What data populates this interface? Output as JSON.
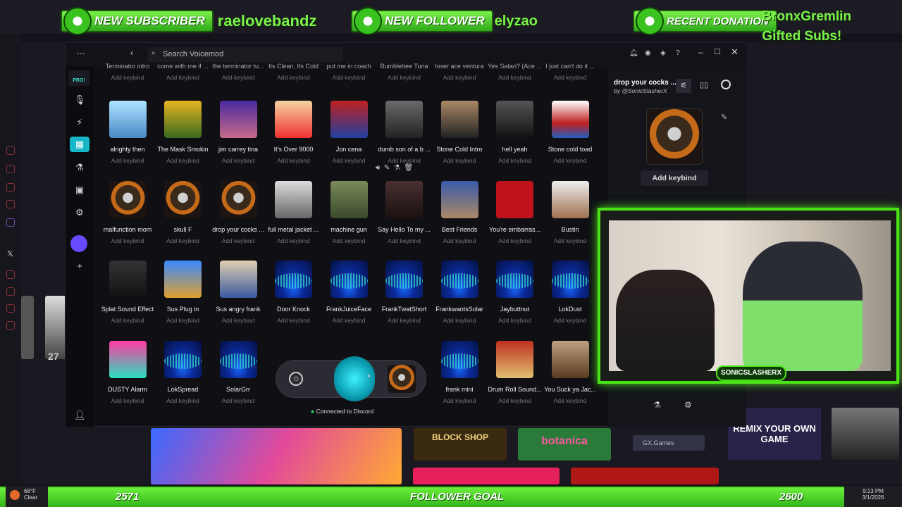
{
  "overlay": {
    "new_subscriber_label": "NEW SUBSCRIBER",
    "new_subscriber_name": "raelovebandz",
    "new_follower_label": "NEW FOLLOWER",
    "new_follower_name": "elyzao",
    "recent_donation_label": "RECENT DONATION",
    "donation_line1": "BronxGremlin",
    "donation_line2": "Gifted Subs!",
    "goal_start": "2571",
    "goal_label": "FOLLOWER GOAL",
    "goal_end": "2600",
    "cam_badge": "SONICSLASHERX"
  },
  "voicemod": {
    "search_placeholder": "Search Voicemod",
    "pro_badge": "PRO!",
    "top_row_labels": [
      "Terminator intro",
      "come with me if ...",
      "the terminator tu...",
      "Its Clean, Its Cold",
      "put me in coach",
      "Bumblebee Tuna",
      "loser ace ventura",
      "Yes Satan? (Ace ...",
      "I just can't do it ..."
    ],
    "keybind_label": "Add keybind",
    "rows": [
      [
        "alrighty then",
        "The Mask Smokin",
        "jim carrey tina",
        "It's Over 9000",
        "Jon cena",
        "dumb son of a b ...",
        "Stone Cold Intro",
        "hell yeah",
        "Stone cold toad"
      ],
      [
        "malfunction mom",
        "skull F",
        "drop your cocks ...",
        "full metal jacket ...",
        "machine gun",
        "Say Hello To my ...",
        "Best Friends",
        "You're embarras...",
        "Bustin"
      ],
      [
        "Splat Sound Effect",
        "Sus Plug in",
        "Sus angry frank",
        "Door Knock",
        "FrankJuiceFace",
        "FrankTwatShort",
        "FrankwantsSolar",
        "Jaybuttnut",
        "LokDust"
      ],
      [
        "DUSTY Alarm",
        "LokSpread",
        "SolarGrr",
        "",
        "",
        "",
        "frank mini",
        "Drum Roll Sound...",
        "You Suck ya Jac..."
      ]
    ],
    "side_title": "drop your cocks ...",
    "side_by": "by @SonicSlasherX",
    "side_keybind": "Add keybind",
    "status": "Connected to Discord"
  },
  "taskbar": {
    "temp": "68°F",
    "weather": "Clear",
    "time": "9:13 PM",
    "date": "3/1/2026"
  },
  "background": {
    "tile_block_shop": "BLOCK SHOP",
    "tile_botanica": "botanica",
    "tile_gx": "GX.Games",
    "tile_remix": "REMIX YOUR OWN GAME",
    "tile_count": "27"
  },
  "colors": {
    "overlay_green": "#4be21a",
    "accent": "#36e0c8"
  }
}
